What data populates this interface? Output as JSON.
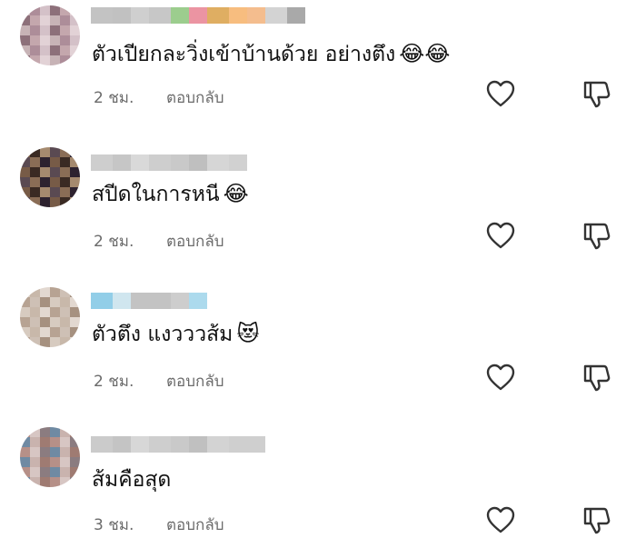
{
  "comments": [
    {
      "text": "ตัวเปียกละวิ่งเข้าบ้านด้วย อย่างตึง",
      "emoji": "😂😂",
      "time": "2 ชม.",
      "reply_label": "ตอบกลับ",
      "avatar_colors": [
        "#c9b2b6",
        "#b08c99",
        "#d6c0c8",
        "#8f6f7a",
        "#c7a6ad",
        "#e3d2d6"
      ],
      "username_colors": [
        "#b8b8b8",
        "#9f9f9f",
        "#c7c7c7",
        "#a9a9a9",
        "#8bc47a",
        "#e05a70",
        "#d9a046",
        "#f39a3a",
        "#f2b27a",
        "#bbbbbb",
        "#9a9a9a"
      ]
    },
    {
      "text": "สปีดในการหนี",
      "emoji": "😂",
      "time": "2 ชม.",
      "reply_label": "ตอบกลับ",
      "avatar_colors": [
        "#7a5a44",
        "#3b2a22",
        "#a88a6c",
        "#5b4a52",
        "#8d6c53",
        "#2e2230"
      ],
      "username_colors": [
        "#c5c5c5",
        "#a7a7a7",
        "#d2d2d2",
        "#b4b4b4",
        "#c0c0c0",
        "#9d9d9d",
        "#cfcfcf",
        "#b9b9b9"
      ]
    },
    {
      "text": "ตัวตึง แงวววส้ม",
      "emoji": "😻",
      "time": "2 ชม.",
      "reply_label": "ตอบกลับ",
      "avatar_colors": [
        "#d8cbbf",
        "#c9b8a8",
        "#e3d8cf",
        "#b9a391",
        "#cfc0b3",
        "#a8917e"
      ],
      "username_colors": [
        "#7fc6e4",
        "#b7d8e6",
        "#b9b9b9",
        "#a3a3a3",
        "#c4c4c4",
        "#7fc6e4"
      ]
    },
    {
      "text": "ส้มคือสุด",
      "emoji": "",
      "time": "3 ชม.",
      "reply_label": "ตอบกลับ",
      "avatar_colors": [
        "#b98f86",
        "#d9c6c2",
        "#8c7c80",
        "#6c8aa6",
        "#cbb3ad",
        "#a27a70"
      ],
      "username_colors": [
        "#c2c2c2",
        "#a5a5a5",
        "#d0d0d0",
        "#b3b3b3",
        "#bfbfbf",
        "#9e9e9e",
        "#cbcbcb",
        "#b6b6b6",
        "#c7c7c7"
      ]
    }
  ],
  "icons": {
    "like": "heart-outline-icon",
    "dislike": "thumbs-down-outline-icon"
  }
}
